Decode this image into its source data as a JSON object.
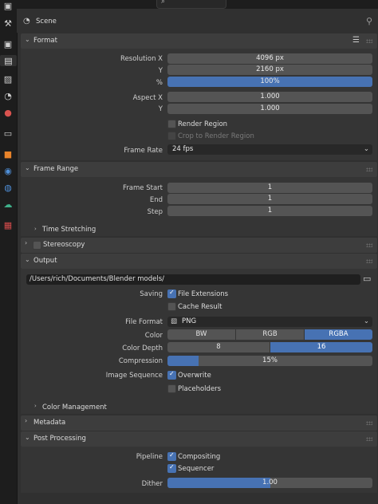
{
  "header": {
    "title": "Scene"
  },
  "tabs": [
    {
      "name": "tool-icon",
      "glyph": "🔧"
    },
    {
      "name": "render-icon",
      "glyph": "▣"
    },
    {
      "name": "output-icon",
      "glyph": "🖨"
    },
    {
      "name": "view-layer-icon",
      "glyph": "▤"
    },
    {
      "name": "scene-icon",
      "glyph": "◔"
    },
    {
      "name": "world-icon",
      "glyph": "🌐"
    },
    {
      "name": "collection-icon",
      "glyph": "▭"
    },
    {
      "name": "object-icon",
      "glyph": "▪"
    },
    {
      "name": "modifier-icon",
      "glyph": "◉"
    },
    {
      "name": "particles-icon",
      "glyph": "◍"
    },
    {
      "name": "physics-icon",
      "glyph": "☁"
    },
    {
      "name": "texture-icon",
      "glyph": "▦"
    }
  ],
  "format": {
    "title": "Format",
    "resolution_x_label": "Resolution X",
    "resolution_x": "4096 px",
    "y_label": "Y",
    "resolution_y": "2160 px",
    "pct_label": "%",
    "percent": "100%",
    "percent_fill": 1.0,
    "aspect_x_label": "Aspect X",
    "aspect_x": "1.000",
    "aspect_y_label": "Y",
    "aspect_y": "1.000",
    "render_region": "Render Region",
    "crop_region": "Crop to Render Region",
    "frame_rate_label": "Frame Rate",
    "frame_rate": "24 fps"
  },
  "frame_range": {
    "title": "Frame Range",
    "start_label": "Frame Start",
    "start": "1",
    "end_label": "End",
    "end": "1",
    "step_label": "Step",
    "step": "1",
    "time_stretching": "Time Stretching"
  },
  "stereoscopy": {
    "title": "Stereoscopy"
  },
  "output": {
    "title": "Output",
    "path": "/Users/rich/Documents/Blender models/",
    "saving_label": "Saving",
    "file_extensions": "File Extensions",
    "cache_result": "Cache Result",
    "file_format_label": "File Format",
    "file_format": "PNG",
    "color_label": "Color",
    "color_options": [
      "BW",
      "RGB",
      "RGBA"
    ],
    "color_selected": "RGBA",
    "depth_label": "Color Depth",
    "depth_options": [
      "8",
      "16"
    ],
    "depth_selected": "16",
    "compression_label": "Compression",
    "compression": "15%",
    "compression_fill": 0.15,
    "sequence_label": "Image Sequence",
    "overwrite": "Overwrite",
    "placeholders": "Placeholders",
    "color_management": "Color Management"
  },
  "metadata": {
    "title": "Metadata"
  },
  "post_processing": {
    "title": "Post Processing",
    "pipeline_label": "Pipeline",
    "compositing": "Compositing",
    "sequencer": "Sequencer",
    "dither_label": "Dither",
    "dither": "1.00",
    "dither_fill": 0.5
  },
  "colors": {
    "accent": "#4772b3",
    "field": "#545454",
    "panel": "#3d3d3d"
  }
}
